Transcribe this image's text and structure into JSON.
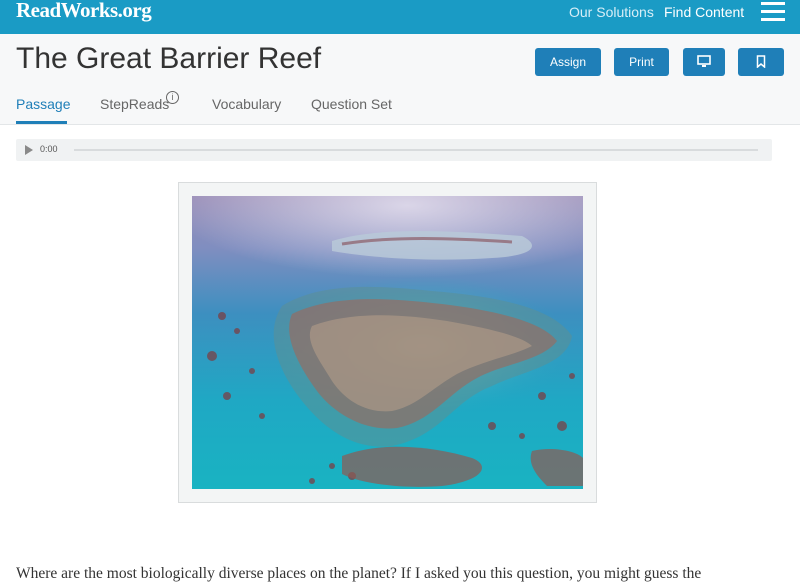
{
  "nav": {
    "logo": "ReadWorks.org",
    "links": [
      "Our Solutions",
      "Find Content"
    ],
    "menu_icon": "hamburger-icon"
  },
  "header": {
    "title": "The Great Barrier Reef",
    "buttons": {
      "assign": "Assign",
      "print": "Print",
      "present_icon": "monitor-icon",
      "bookmark_icon": "bookmark-icon"
    }
  },
  "tabs": [
    {
      "label": "Passage",
      "active": true
    },
    {
      "label": "StepReads",
      "info_icon": "info-icon"
    },
    {
      "label": "Vocabulary"
    },
    {
      "label": "Question Set"
    }
  ],
  "audio": {
    "time": "0:00",
    "play_icon": "play-icon"
  },
  "passage": {
    "image_alt": "aerial view of coral reef",
    "first_line": "Where are the most biologically diverse places on the planet? If I asked you this question, you might guess the"
  },
  "colors": {
    "brand": "#1a9bc5",
    "button": "#1f7fb8",
    "active_tab": "#1f7fb8"
  }
}
